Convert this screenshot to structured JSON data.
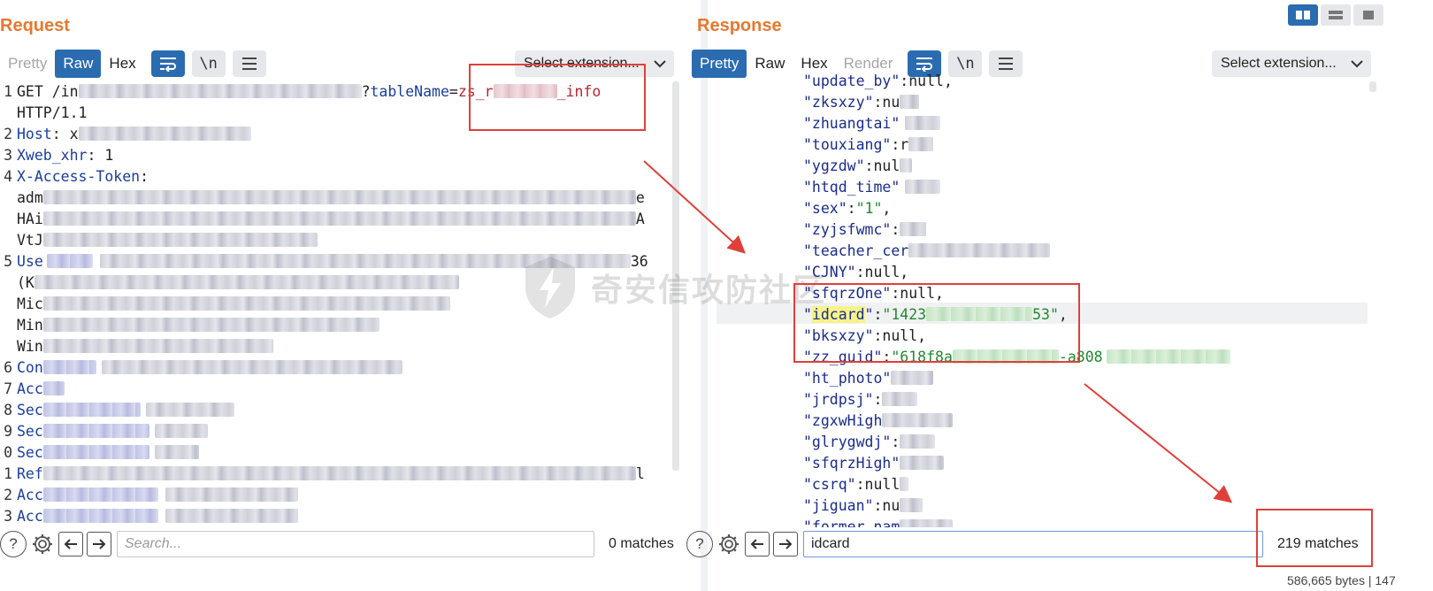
{
  "request": {
    "title": "Request",
    "tabs": [
      "Pretty",
      "Raw",
      "Hex"
    ],
    "active_tab": "Raw",
    "wrap_label": "\\n",
    "extension_select": "Select extension...",
    "search_placeholder": "Search...",
    "matches": "0 matches",
    "lines": [
      {
        "n": "1",
        "method": "GET",
        "path": "/in",
        "param_name": "tableName",
        "param_eq": "=",
        "param_value_start": "zs_r",
        "param_value_end": "_info"
      },
      {
        "n": "",
        "text": "HTTP/1.1"
      },
      {
        "n": "2",
        "name": "Host",
        "value": " x"
      },
      {
        "n": "3",
        "name": "Xweb_xhr",
        "value": " 1"
      },
      {
        "n": "4",
        "name": "X-Access-Token",
        "value": ""
      },
      {
        "n": "",
        "text": "adm",
        "tail": "e"
      },
      {
        "n": "",
        "text": "HAi",
        "tail": "A"
      },
      {
        "n": "",
        "text": "VtJ"
      },
      {
        "n": "5",
        "name": "Use",
        "tail": "36"
      },
      {
        "n": "",
        "text": " (K"
      },
      {
        "n": "",
        "text": "Mic"
      },
      {
        "n": "",
        "text": "Min"
      },
      {
        "n": "",
        "text": "Win"
      },
      {
        "n": "6",
        "name": "Con"
      },
      {
        "n": "7",
        "name": "Acc"
      },
      {
        "n": "8",
        "name": "Sec"
      },
      {
        "n": "9",
        "name": "Sec"
      },
      {
        "n": "0",
        "name": "Sec"
      },
      {
        "n": "1",
        "name": "Ref",
        "tail": "l"
      },
      {
        "n": "2",
        "name": "Acc"
      },
      {
        "n": "3",
        "name": "Acc"
      }
    ]
  },
  "response": {
    "title": "Response",
    "tabs": [
      "Pretty",
      "Raw",
      "Hex",
      "Render"
    ],
    "active_tab": "Pretty",
    "disabled_tab": "Render",
    "wrap_label": "\\n",
    "extension_select": "Select extension...",
    "search_value": "idcard",
    "matches": "219 matches",
    "byte_info": "586,665 bytes | 147",
    "lines": [
      {
        "key": "\"update_by\"",
        "rest": ":null,"
      },
      {
        "key": "\"zksxzy\"",
        "rest": ":nu"
      },
      {
        "key": "\"zhuangtai\"",
        "rest": ""
      },
      {
        "key": "\"touxiang\"",
        "rest": ":r"
      },
      {
        "key": "\"ygzdw\"",
        "rest": ":nul"
      },
      {
        "key": "\"htqd_time\"",
        "rest": ""
      },
      {
        "key": "\"sex\"",
        "rest": ":",
        "str": "\"1\"",
        "after": ","
      },
      {
        "key": "\"zyjsfwmc\"",
        "rest": ":"
      },
      {
        "key": "\"teacher_cer",
        "rest": ""
      },
      {
        "key": "\"CJNY\"",
        "rest": ":null,"
      },
      {
        "key": "\"sfqrzOne\"",
        "rest": ":null,"
      },
      {
        "key_q1": "\"",
        "key_hl": "idcard",
        "key_q2": "\"",
        "rest": ":",
        "str": "\"1423",
        "str_end": "53\"",
        "after": ","
      },
      {
        "key": "\"bksxzy\"",
        "rest": ":null,"
      },
      {
        "key": "\"zz_guid\"",
        "rest": ":",
        "str": "\"618f8a",
        "str_mid": "-a808"
      },
      {
        "key": "\"ht_photo\"",
        "rest": ""
      },
      {
        "key": "\"jrdpsj\"",
        "rest": ":"
      },
      {
        "key": "\"zgxwHigh",
        "rest": ""
      },
      {
        "key": "\"glrygwdj\"",
        "rest": ":"
      },
      {
        "key": "\"sfqrzHigh\"",
        "rest": ""
      },
      {
        "key": "\"csrq\"",
        "rest": ":null"
      },
      {
        "key": "\"jiguan\"",
        "rest": ":nu"
      },
      {
        "key": "\"former_nam",
        "rest": ""
      }
    ]
  },
  "watermark": "奇安信攻防社区",
  "icons": {
    "help": "question-mark-circle-icon",
    "settings": "gear-icon",
    "back": "arrow-left-icon",
    "forward": "arrow-right-icon",
    "wrap": "wrap-lines-icon",
    "menu": "hamburger-menu-icon",
    "dropdown": "chevron-down-icon"
  },
  "colors": {
    "title": "#e8772e",
    "active_tab": "#2b6cb0",
    "annotation": "#e0403a",
    "json_key": "#1a2c8c",
    "json_string": "#1f8a2e",
    "search_highlight": "#f6f38b"
  }
}
